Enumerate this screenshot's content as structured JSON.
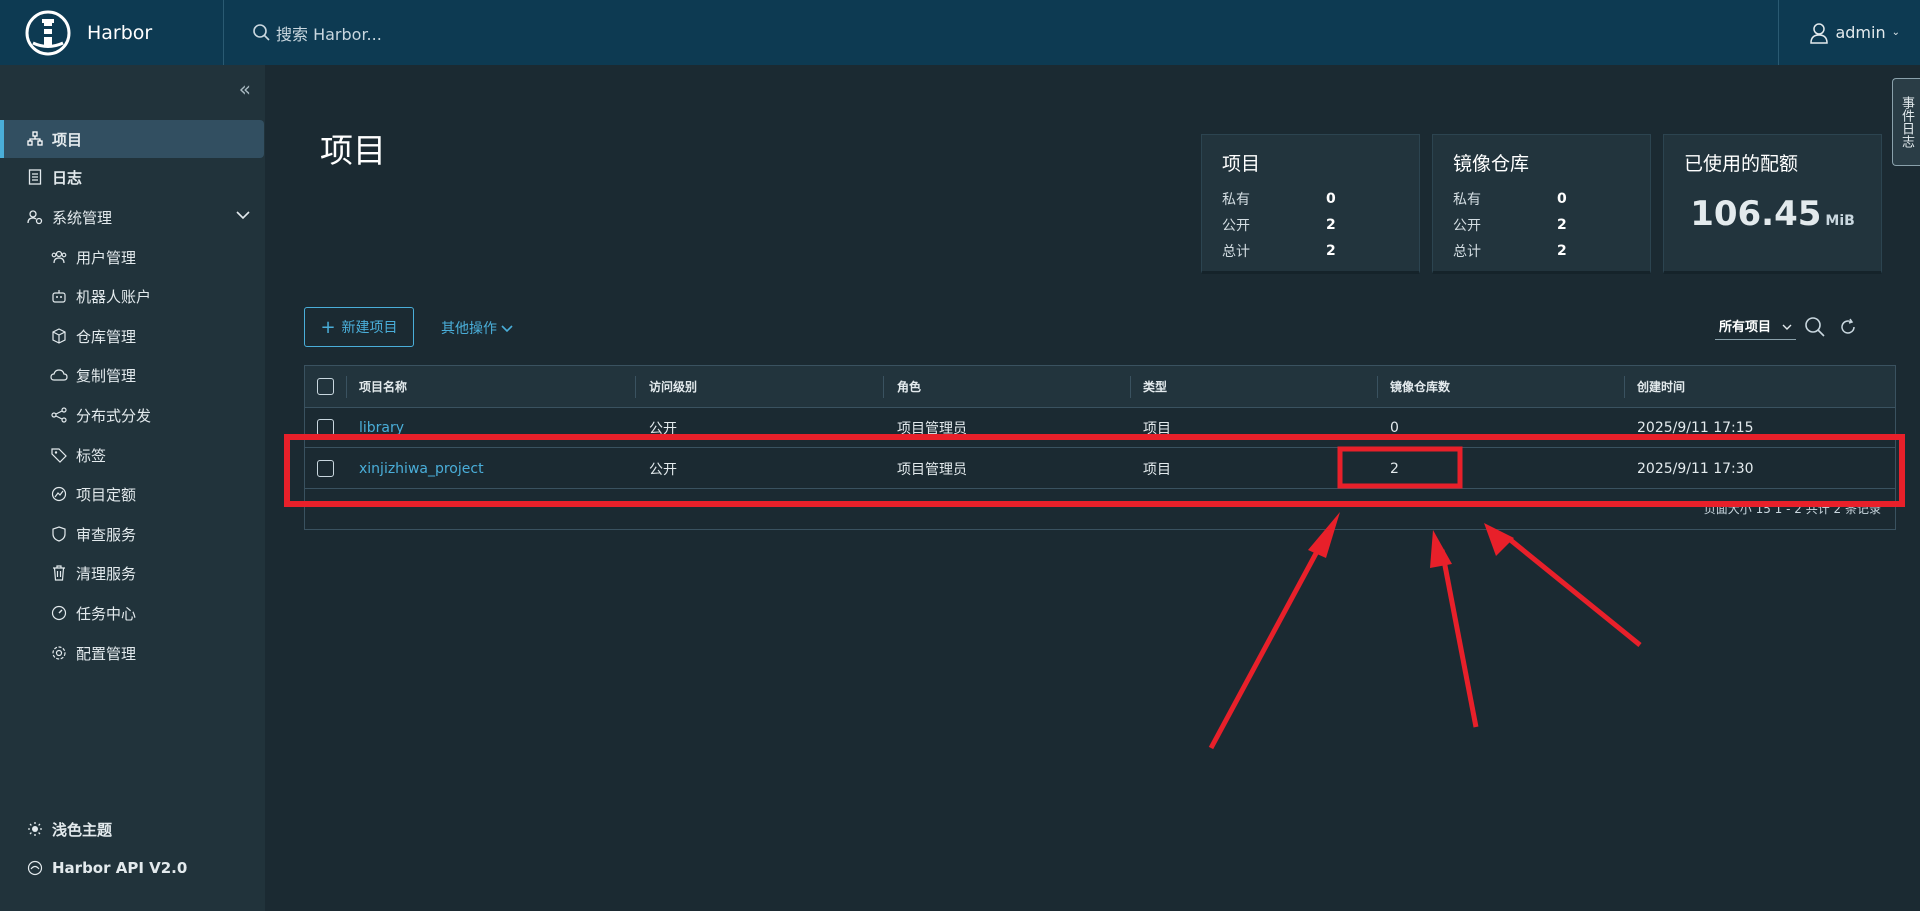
{
  "header": {
    "app_name": "Harbor",
    "search_placeholder": "搜索 Harbor...",
    "user": "admin"
  },
  "sidebar": {
    "items": [
      {
        "label": "项目",
        "icon": "projects-icon"
      },
      {
        "label": "日志",
        "icon": "log-icon"
      },
      {
        "label": "系统管理",
        "icon": "admin-icon"
      },
      {
        "label": "用户管理",
        "icon": "users-icon"
      },
      {
        "label": "机器人账户",
        "icon": "robot-icon"
      },
      {
        "label": "仓库管理",
        "icon": "registry-icon"
      },
      {
        "label": "复制管理",
        "icon": "replication-icon"
      },
      {
        "label": "分布式分发",
        "icon": "distribution-icon"
      },
      {
        "label": "标签",
        "icon": "tag-icon"
      },
      {
        "label": "项目定额",
        "icon": "quota-icon"
      },
      {
        "label": "审查服务",
        "icon": "shield-icon"
      },
      {
        "label": "清理服务",
        "icon": "trash-icon"
      },
      {
        "label": "任务中心",
        "icon": "dashboard-icon"
      },
      {
        "label": "配置管理",
        "icon": "gear-icon"
      }
    ],
    "theme": "浅色主题",
    "api": "Harbor API V2.0"
  },
  "main": {
    "title": "项目",
    "cards": {
      "projects": {
        "title": "项目",
        "private_label": "私有",
        "private": "0",
        "public_label": "公开",
        "public": "2",
        "total_label": "总计",
        "total": "2"
      },
      "repos": {
        "title": "镜像仓库",
        "private_label": "私有",
        "private": "0",
        "public_label": "公开",
        "public": "2",
        "total_label": "总计",
        "total": "2"
      },
      "quota": {
        "title": "已使用的配额",
        "value": "106.45",
        "unit": "MiB"
      }
    },
    "new_project": "新建项目",
    "more_actions": "其他操作",
    "filter": "所有项目",
    "table": {
      "columns": [
        "项目名称",
        "访问级别",
        "角色",
        "类型",
        "镜像仓库数",
        "创建时间"
      ],
      "rows": [
        [
          "library",
          "公开",
          "项目管理员",
          "项目",
          "0",
          "2025/9/11 17:15"
        ],
        [
          "xinjizhiwa_project",
          "公开",
          "项目管理员",
          "项目",
          "2",
          "2025/9/11 17:30"
        ]
      ],
      "pager": "页面大小 15     1 - 2 共计 2 条记录"
    },
    "event_log_tab": "事件日志"
  },
  "colors": {
    "accent": "#4aaed9",
    "header_bg": "#0d3a52",
    "annotation": "#e8202a"
  }
}
